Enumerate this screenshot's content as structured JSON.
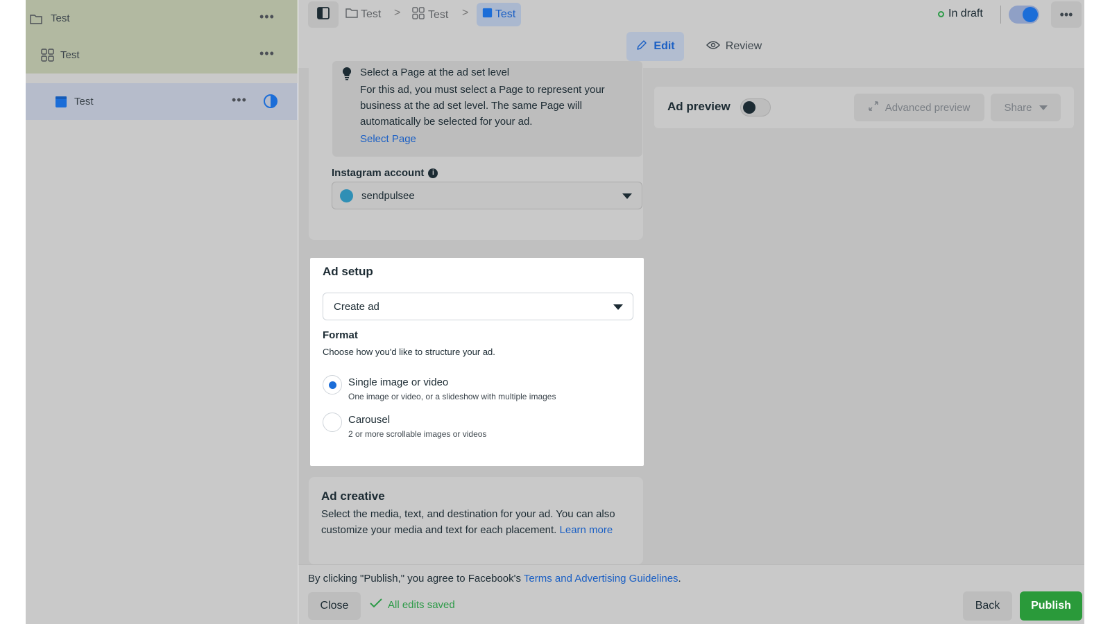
{
  "nav": {
    "campaign": {
      "label": "Test"
    },
    "adset": {
      "label": "Test"
    },
    "ad": {
      "label": "Test"
    },
    "more": "•••"
  },
  "breadcrumb": {
    "items": [
      {
        "label": "Test",
        "icon": "folder-icon"
      },
      {
        "label": "Test",
        "icon": "grid-icon"
      },
      {
        "label": "Test",
        "icon": "ad-square-icon"
      }
    ],
    "separator": ">"
  },
  "status": {
    "label": "In draft",
    "toggle_on": true,
    "more": "•••"
  },
  "tabs": {
    "edit": "Edit",
    "review": "Review"
  },
  "page_tip": {
    "title": "Select a Page at the ad set level",
    "body": "For this ad, you must select a Page to represent your business at the ad set level. The same Page will automatically be selected for your ad.",
    "link": "Select Page"
  },
  "instagram": {
    "label": "Instagram account",
    "value": "sendpulsee"
  },
  "ad_setup": {
    "title": "Ad setup",
    "select_value": "Create ad",
    "format_title": "Format",
    "format_sub": "Choose how you'd like to structure your ad.",
    "options": [
      {
        "title": "Single image or video",
        "sub": "One image or video, or a slideshow with multiple images",
        "selected": true
      },
      {
        "title": "Carousel",
        "sub": "2 or more scrollable images or videos",
        "selected": false
      }
    ]
  },
  "ad_creative": {
    "title": "Ad creative",
    "body": "Select the media, text, and destination for your ad. You can also customize your media and text for each placement.",
    "link": "Learn more"
  },
  "preview": {
    "title": "Ad preview",
    "toggle_on": false,
    "advanced": "Advanced preview",
    "share": "Share"
  },
  "footer": {
    "terms_prefix": "By clicking \"Publish,\" you agree to Facebook's",
    "terms_link": "Terms and Advertising Guidelines",
    "terms_suffix": ".",
    "close": "Close",
    "saved": "All edits saved",
    "back": "Back",
    "publish": "Publish"
  },
  "colors": {
    "accent": "#1b6dd8",
    "link": "#1a5fc4",
    "publish": "#2a9a3a",
    "success": "#2c9a47"
  }
}
